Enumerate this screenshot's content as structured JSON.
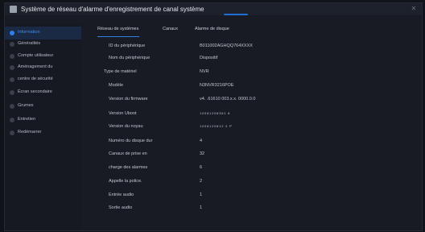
{
  "window": {
    "title": "Système de réseau d'alarme d'enregistrement de canal système"
  },
  "sidebar": {
    "items": [
      {
        "label": "Information",
        "active": true
      },
      {
        "label": "Généralités"
      },
      {
        "label": "Compte utilisateur"
      },
      {
        "label": "Aménagement du"
      },
      {
        "label": "centre de sécurité"
      },
      {
        "label": "Écran secondaire"
      },
      {
        "label": "Grumes"
      },
      {
        "label": "Entretien"
      },
      {
        "label": "Redémarrer"
      }
    ]
  },
  "tabs": [
    {
      "label": "Réseau de systèmes",
      "active": true
    },
    {
      "label": "Canaux"
    },
    {
      "label": "Alarme de disque"
    }
  ],
  "info": [
    {
      "key": "ID du périphérique",
      "value": "B011002AGHQQ764XXXX"
    },
    {
      "key": "Nom du périphérique",
      "value": "Dispositif"
    },
    {
      "key": "Type de matériel",
      "value": "NVR"
    },
    {
      "key": "Modèle",
      "value": "N3NVR3216POE"
    },
    {
      "key": "Version du firmware",
      "value": "v4. .61610 003.x.x. 0000.0.0"
    },
    {
      "key": "Version Uboot",
      "value": "10081208361 8"
    },
    {
      "key": "Version du noyau",
      "value": "1008120812 2 P"
    },
    {
      "key": "Numéro du disque dur",
      "value": "4"
    },
    {
      "key": "Canaux de prise en",
      "value": "32"
    },
    {
      "key": "charge des alarmes",
      "value": "6"
    },
    {
      "key": "Appelle la police.",
      "value": "2"
    },
    {
      "key": "Entrée audio",
      "value": "1"
    },
    {
      "key": "Sortie audio",
      "value": "1"
    }
  ],
  "colors": {
    "accent": "#2f7fe6",
    "background": "#181b24"
  }
}
